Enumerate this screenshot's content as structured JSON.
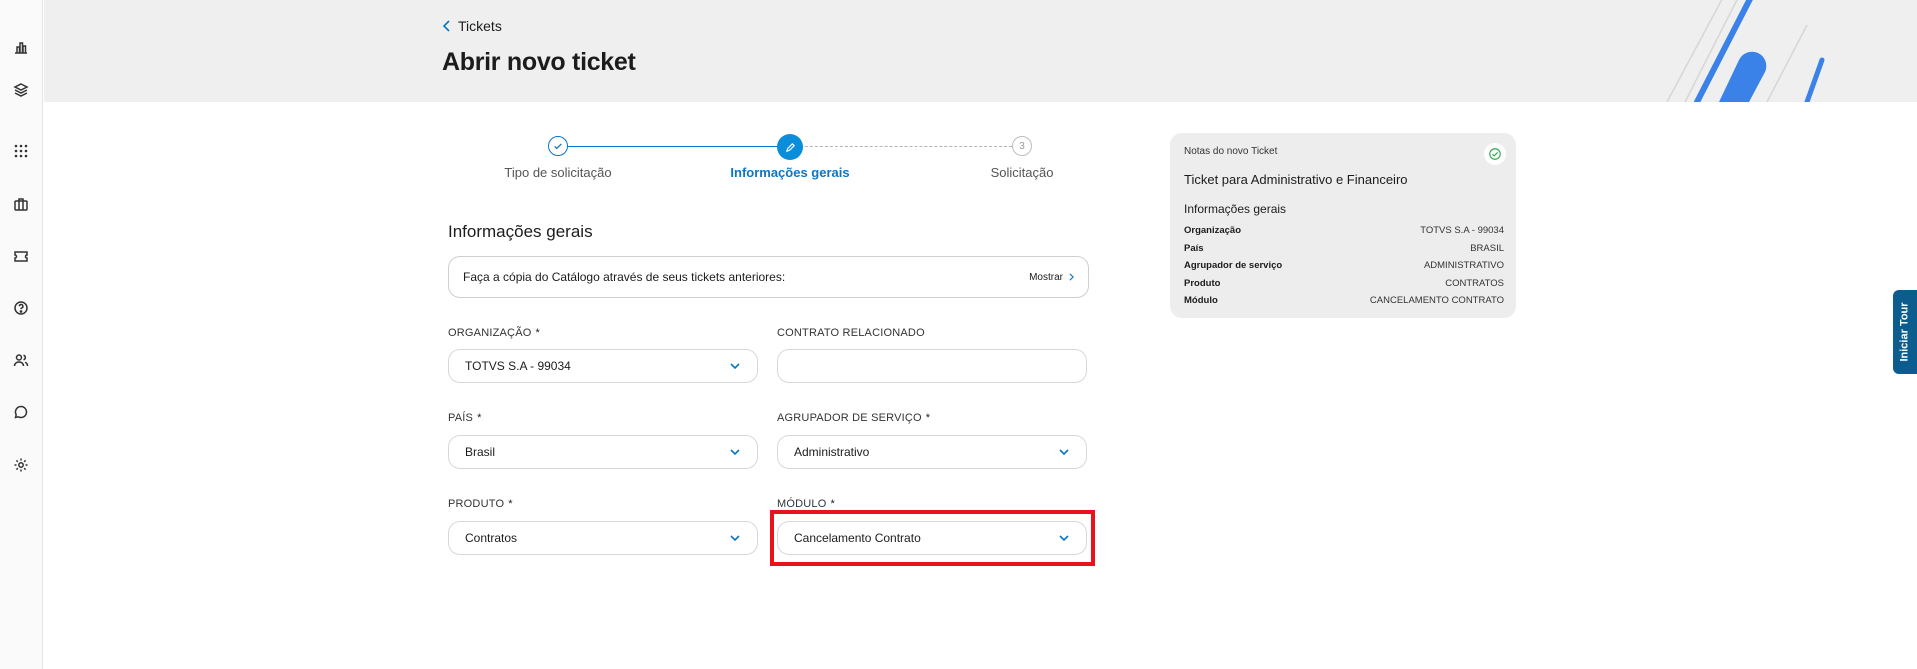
{
  "rail": {
    "items": [
      "chart-icon",
      "layers-icon",
      "apps-grid-icon",
      "briefcase-icon",
      "ticket-icon",
      "help-icon",
      "users-icon",
      "chat-icon",
      "gear-icon"
    ]
  },
  "header": {
    "breadcrumb": "Tickets",
    "title": "Abrir novo ticket"
  },
  "stepper": {
    "steps": [
      {
        "label": "Tipo de solicitação",
        "state": "done"
      },
      {
        "label": "Informações gerais",
        "state": "active"
      },
      {
        "label": "Solicitação",
        "state": "pending",
        "number": "3"
      }
    ]
  },
  "form": {
    "section_title": "Informações gerais",
    "copy_prompt": "Faça a cópia do Catálogo através de seus tickets anteriores:",
    "copy_action": "Mostrar",
    "fields": {
      "organizacao": {
        "label": "ORGANIZAÇÃO",
        "required": "*",
        "value": "TOTVS S.A - 99034"
      },
      "contrato": {
        "label": "CONTRATO RELACIONADO",
        "value": ""
      },
      "pais": {
        "label": "PAÍS",
        "required": "*",
        "value": "Brasil"
      },
      "agrupador": {
        "label": "AGRUPADOR DE SERVIÇO",
        "required": "*",
        "value": "Administrativo"
      },
      "produto": {
        "label": "PRODUTO",
        "required": "*",
        "value": "Contratos"
      },
      "modulo": {
        "label": "MÓDULO",
        "required": "*",
        "value": "Cancelamento Contrato"
      }
    }
  },
  "notes": {
    "header": "Notas do novo Ticket",
    "subtitle": "Ticket para Administrativo e Financeiro",
    "section": "Informações gerais",
    "rows": [
      {
        "key": "Organização",
        "value": "TOTVS S.A - 99034"
      },
      {
        "key": "País",
        "value": "BRASIL"
      },
      {
        "key": "Agrupador de serviço",
        "value": "ADMINISTRATIVO"
      },
      {
        "key": "Produto",
        "value": "CONTRATOS"
      },
      {
        "key": "Módulo",
        "value": "CANCELAMENTO CONTRATO"
      }
    ]
  },
  "tour": {
    "label": "Iniciar Tour"
  },
  "colors": {
    "accent": "#0b76c5",
    "highlight": "#e8141c",
    "tour": "#0c5c8e"
  }
}
